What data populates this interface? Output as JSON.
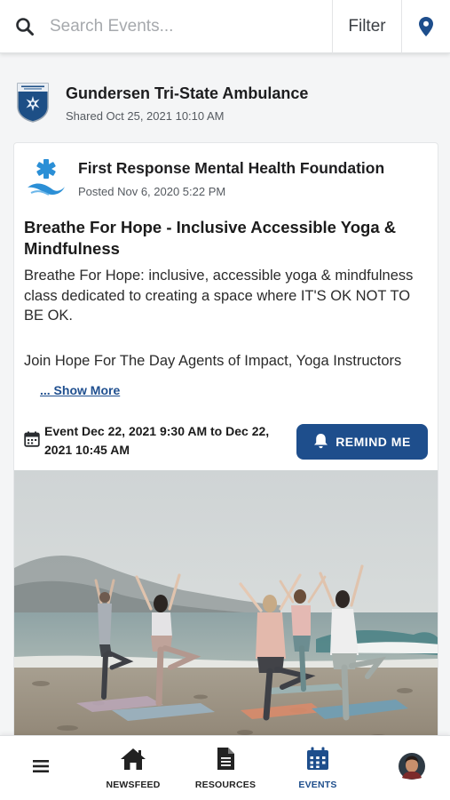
{
  "search": {
    "placeholder": "Search Events..."
  },
  "topbar": {
    "filter_label": "Filter",
    "location_icon": "map-pin-icon"
  },
  "shared": {
    "name": "Gundersen Tri-State Ambulance",
    "date": "Shared Oct 25, 2021 10:10 AM"
  },
  "post": {
    "org_name": "First Response Mental Health Foundation",
    "posted": "Posted Nov 6, 2020 5:22 PM",
    "title": "Breathe For Hope - Inclusive Accessible Yoga & Mindfulness",
    "body": "Breathe For Hope: inclusive, accessible yoga & mindfulness class dedicated to creating a space where IT'S OK NOT TO BE OK.",
    "body2": "Join Hope For The Day Agents of Impact, Yoga Instructors",
    "show_more": "... Show More",
    "event_text": "Event Dec 22, 2021 9:30 AM to Dec 22, 2021 10:45 AM",
    "remind_label": "REMIND ME"
  },
  "nav": {
    "items": [
      {
        "label": "",
        "icon": "menu-icon"
      },
      {
        "label": "NEWSFEED",
        "icon": "home-icon"
      },
      {
        "label": "RESOURCES",
        "icon": "document-icon"
      },
      {
        "label": "EVENTS",
        "icon": "calendar-icon",
        "active": true
      },
      {
        "label": "",
        "icon": "avatar"
      }
    ]
  },
  "colors": {
    "accent": "#1e4e8c",
    "background": "#f4f5f6"
  }
}
